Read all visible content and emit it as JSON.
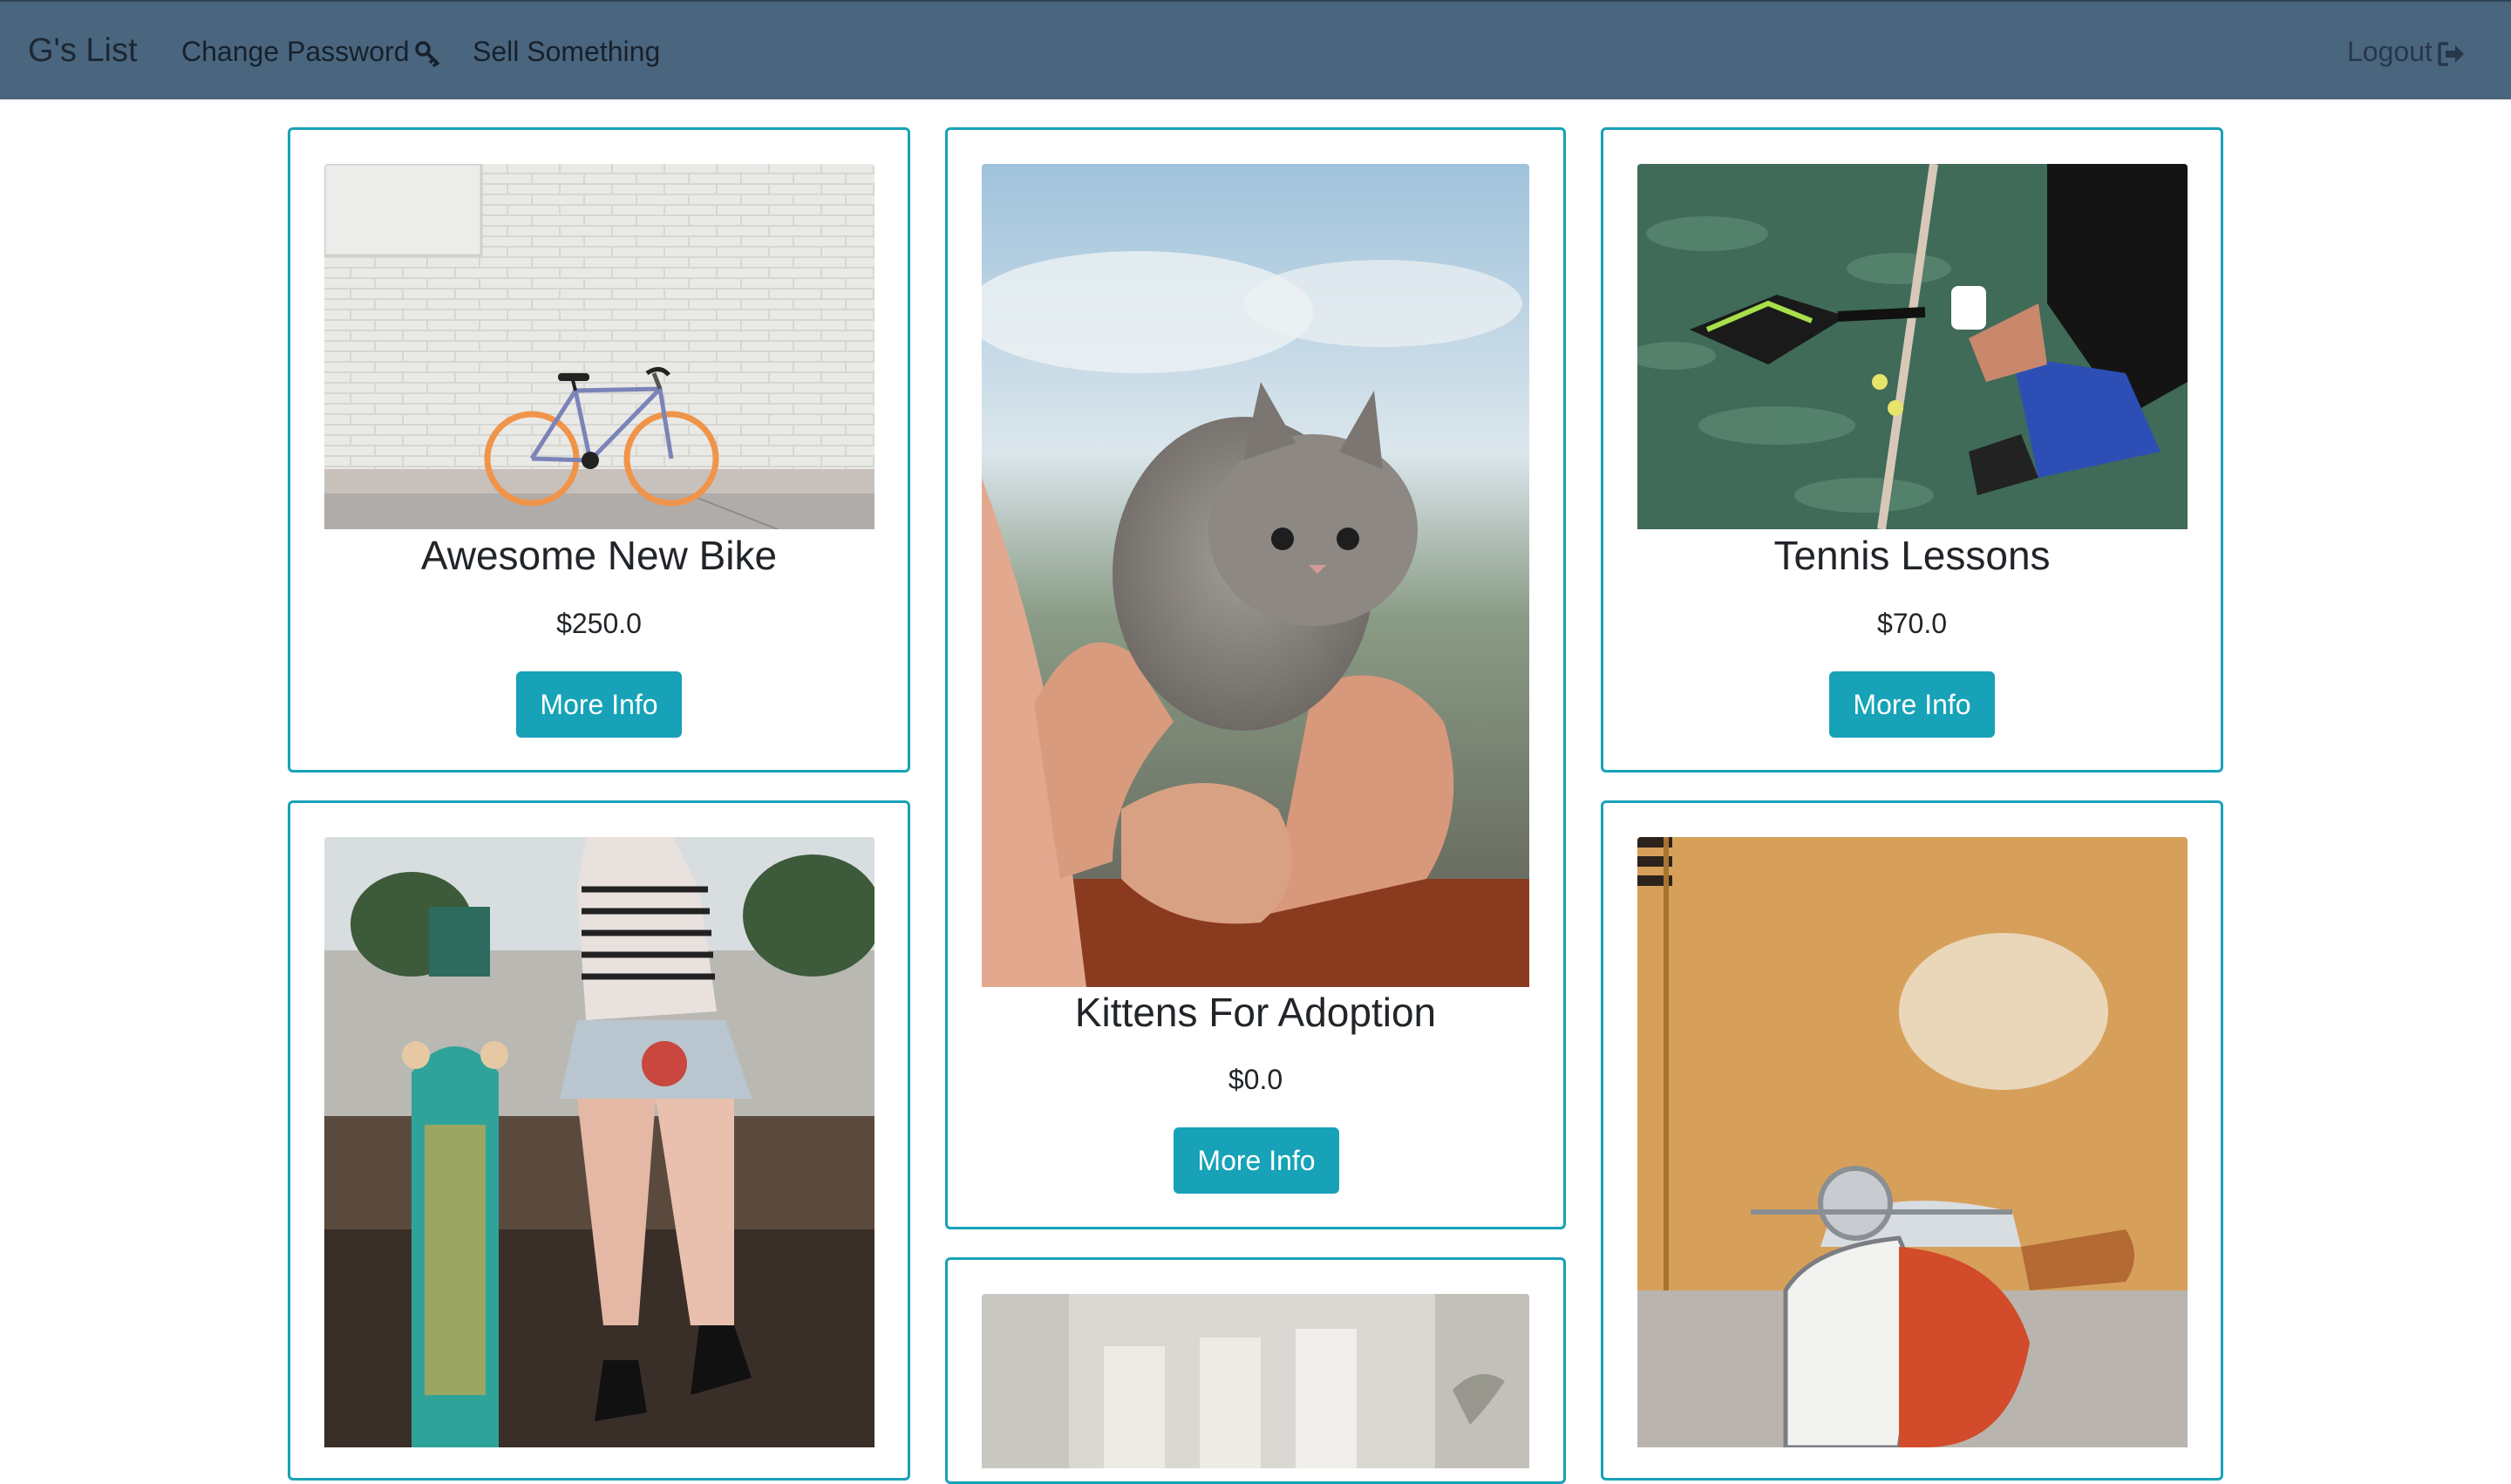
{
  "navbar": {
    "brand": "G's List",
    "change_password": "Change Password",
    "sell_something": "Sell Something",
    "logout": "Logout",
    "icons": [
      "key-icon",
      "sign-out-icon"
    ]
  },
  "listings": [
    {
      "title": "Awesome New Bike",
      "price": "$250.0",
      "button": "More Info",
      "image": "bicycle-photo"
    },
    {
      "title": "Kittens For Adoption",
      "price": "$0.0",
      "button": "More Info",
      "image": "kitten-photo"
    },
    {
      "title": "Tennis Lessons",
      "price": "$70.0",
      "button": "More Info",
      "image": "tennis-photo"
    },
    {
      "title": "",
      "price": "",
      "button": "",
      "image": "skateboard-photo"
    },
    {
      "title": "",
      "price": "",
      "button": "",
      "image": "window-light-photo"
    },
    {
      "title": "",
      "price": "",
      "button": "",
      "image": "scooter-photo"
    }
  ],
  "colors": {
    "navbar": "#4a667e",
    "accent": "#17a2b8",
    "button_text": "#ffffff"
  }
}
